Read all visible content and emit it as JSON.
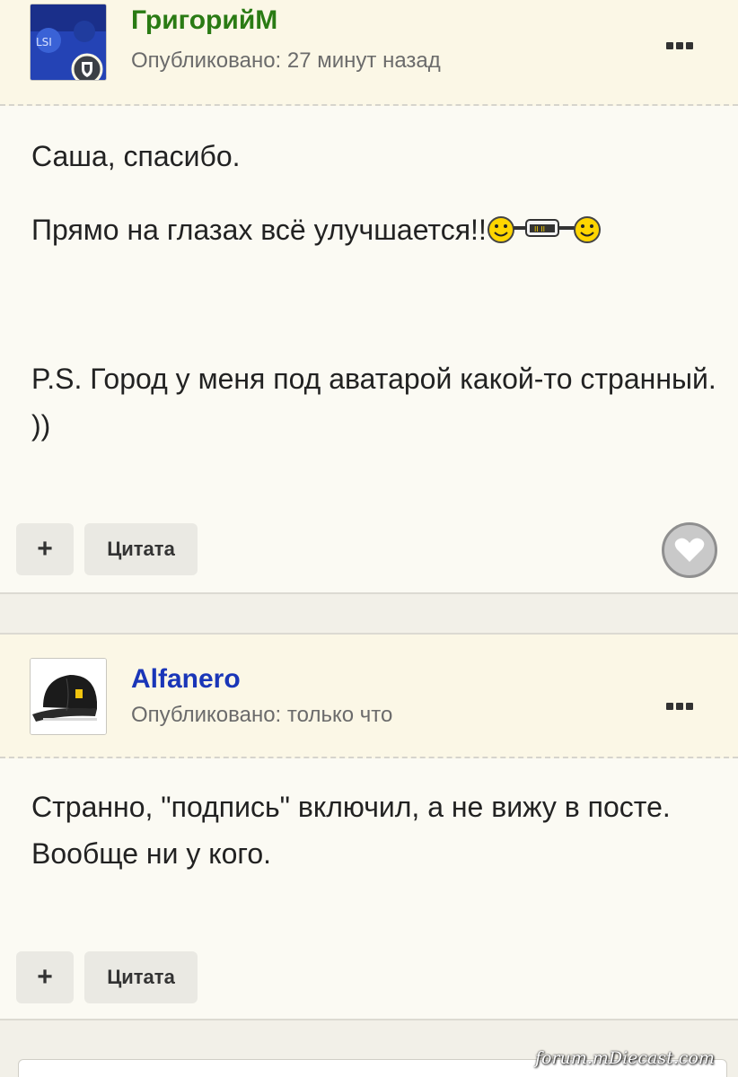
{
  "posts": [
    {
      "author": "ГригорийМ",
      "published": "Опубликовано: 27 минут назад",
      "paragraphs": [
        "Саша, спасибо.",
        "Прямо на глазах всё улучшается!!",
        "P.S. Город у меня под аватарой какой-то странный. ))"
      ],
      "plus_label": "+",
      "quote_label": "Цитата",
      "author_color": "#2a7b14"
    },
    {
      "author": "Alfanero",
      "published": "Опубликовано: только что",
      "paragraphs": [
        "Странно, \"подпись\" включил, а не вижу в посте. Вообще ни у кого."
      ],
      "plus_label": "+",
      "quote_label": "Цитата",
      "author_color": "#1a36b8"
    }
  ],
  "icons": {
    "more": "more-options-icon",
    "like": "heart-icon",
    "emoji": "smiley-icon",
    "badge": "shield-badge-icon"
  },
  "watermark": "forum.mDiecast.com"
}
